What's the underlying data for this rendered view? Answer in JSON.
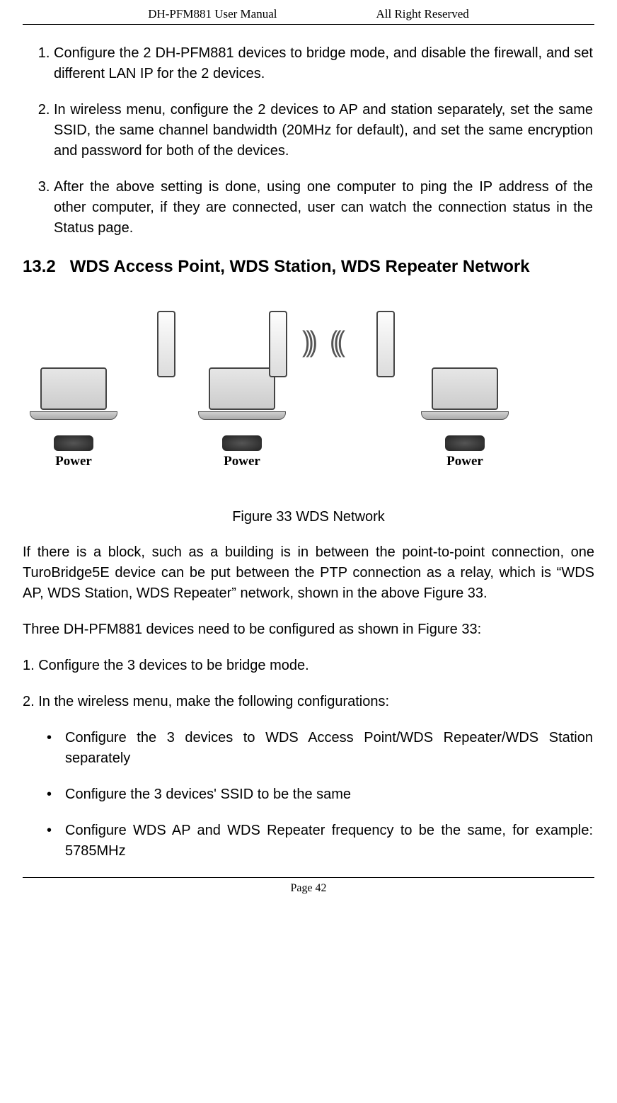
{
  "header": {
    "left": "DH-PFM881 User Manual",
    "right": "All Right Reserved"
  },
  "list1": [
    "Configure the 2 DH-PFM881 devices to bridge mode, and disable the firewall, and set different LAN IP for the 2 devices.",
    "In wireless menu, configure the 2 devices to AP and station separately, set the same SSID, the same channel bandwidth (20MHz for default), and set the same encryption and password for both of the devices.",
    "After the above setting is done, using one computer to ping the IP address of the other computer, if they are connected, user can watch the connection status in the Status page."
  ],
  "section": {
    "num": "13.2",
    "title": "WDS Access Point, WDS Station, WDS Repeater Network"
  },
  "figure": {
    "labels": [
      "Power",
      "Power",
      "Power"
    ],
    "caption": "Figure 33 WDS Network"
  },
  "para1": "If there is a block, such as a building is in between the point-to-point connection, one TuroBridge5E device can be put between the PTP connection as a relay, which is “WDS AP, WDS Station, WDS Repeater” network, shown in the above Figure 33.",
  "para2": "Three DH-PFM881 devices need to be configured as shown in Figure 33:",
  "para3": "1. Configure the 3 devices to be bridge mode.",
  "para4": "2. In the wireless menu, make the following configurations:",
  "bullets": [
    "Configure the 3 devices to WDS Access Point/WDS Repeater/WDS Station separately",
    "Configure the 3 devices' SSID to be the same",
    "Configure WDS AP and WDS Repeater frequency to be the same, for example: 5785MHz"
  ],
  "footer": "Page 42"
}
